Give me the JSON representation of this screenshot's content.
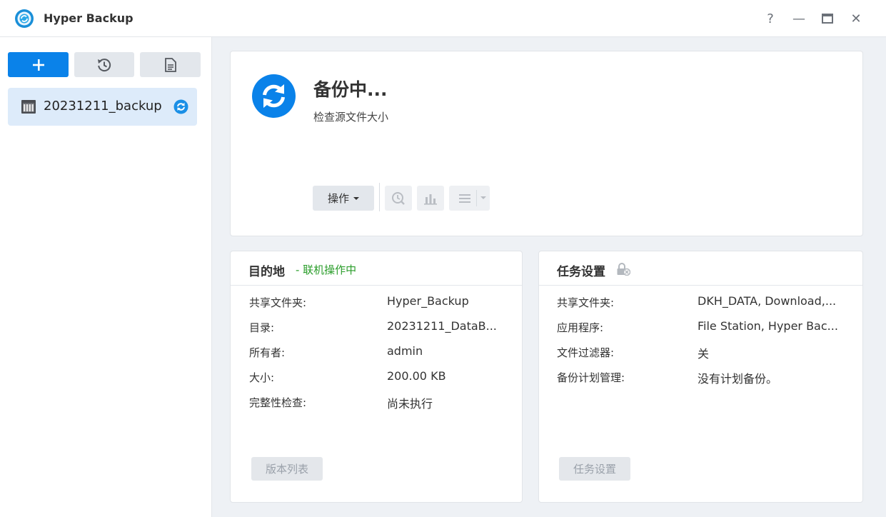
{
  "window": {
    "title": "Hyper Backup",
    "help_label": "?",
    "minimize_label": "—",
    "close_label": "✕"
  },
  "sidebar": {
    "tasks": [
      {
        "label": "20231211_backup",
        "status_icon": "sync-icon"
      }
    ]
  },
  "status": {
    "title": "备份中...",
    "subtitle": "检查源文件大小",
    "action_button": "操作",
    "accent_color": "#0a82e9"
  },
  "destination": {
    "title": "目的地",
    "status_text": "- 联机操作中",
    "rows": [
      {
        "label": "共享文件夹:",
        "value": "Hyper_Backup"
      },
      {
        "label": "目录:",
        "value": "20231211_DataB..."
      },
      {
        "label": "所有者:",
        "value": "admin"
      },
      {
        "label": "大小:",
        "value": "200.00 KB"
      },
      {
        "label": "完整性检查:",
        "value": "尚未执行"
      }
    ],
    "button": "版本列表"
  },
  "task_settings": {
    "title": "任务设置",
    "rows": [
      {
        "label": "共享文件夹:",
        "value": "DKH_DATA, Download,..."
      },
      {
        "label": "应用程序:",
        "value": "File Station, Hyper Bac..."
      },
      {
        "label": "文件过滤器:",
        "value": "关"
      },
      {
        "label": "备份计划管理:",
        "value": "没有计划备份。"
      }
    ],
    "button": "任务设置"
  }
}
